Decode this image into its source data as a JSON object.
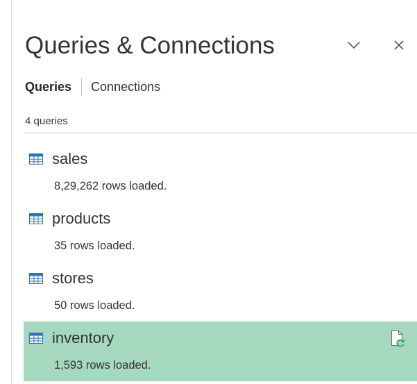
{
  "pane": {
    "title": "Queries & Connections",
    "collapse_icon": "chevron-down-icon",
    "close_icon": "close-icon"
  },
  "tabs": [
    {
      "label": "Queries",
      "active": true
    },
    {
      "label": "Connections",
      "active": false
    }
  ],
  "query_count": "4 queries",
  "queries": [
    {
      "name": "sales",
      "status": "8,29,262 rows loaded.",
      "icon": "table-icon",
      "selected": false
    },
    {
      "name": "products",
      "status": "35 rows loaded.",
      "icon": "table-icon",
      "selected": false
    },
    {
      "name": "stores",
      "status": "50 rows loaded.",
      "icon": "table-icon",
      "selected": false
    },
    {
      "name": "inventory",
      "status": "1,593 rows loaded.",
      "icon": "table-icon",
      "selected": true,
      "action_icon": "refresh-document-icon"
    }
  ],
  "colors": {
    "selected_background": "#a6d8bf",
    "table_icon": "#2e75b6",
    "refresh_green": "#3a9f5e"
  }
}
